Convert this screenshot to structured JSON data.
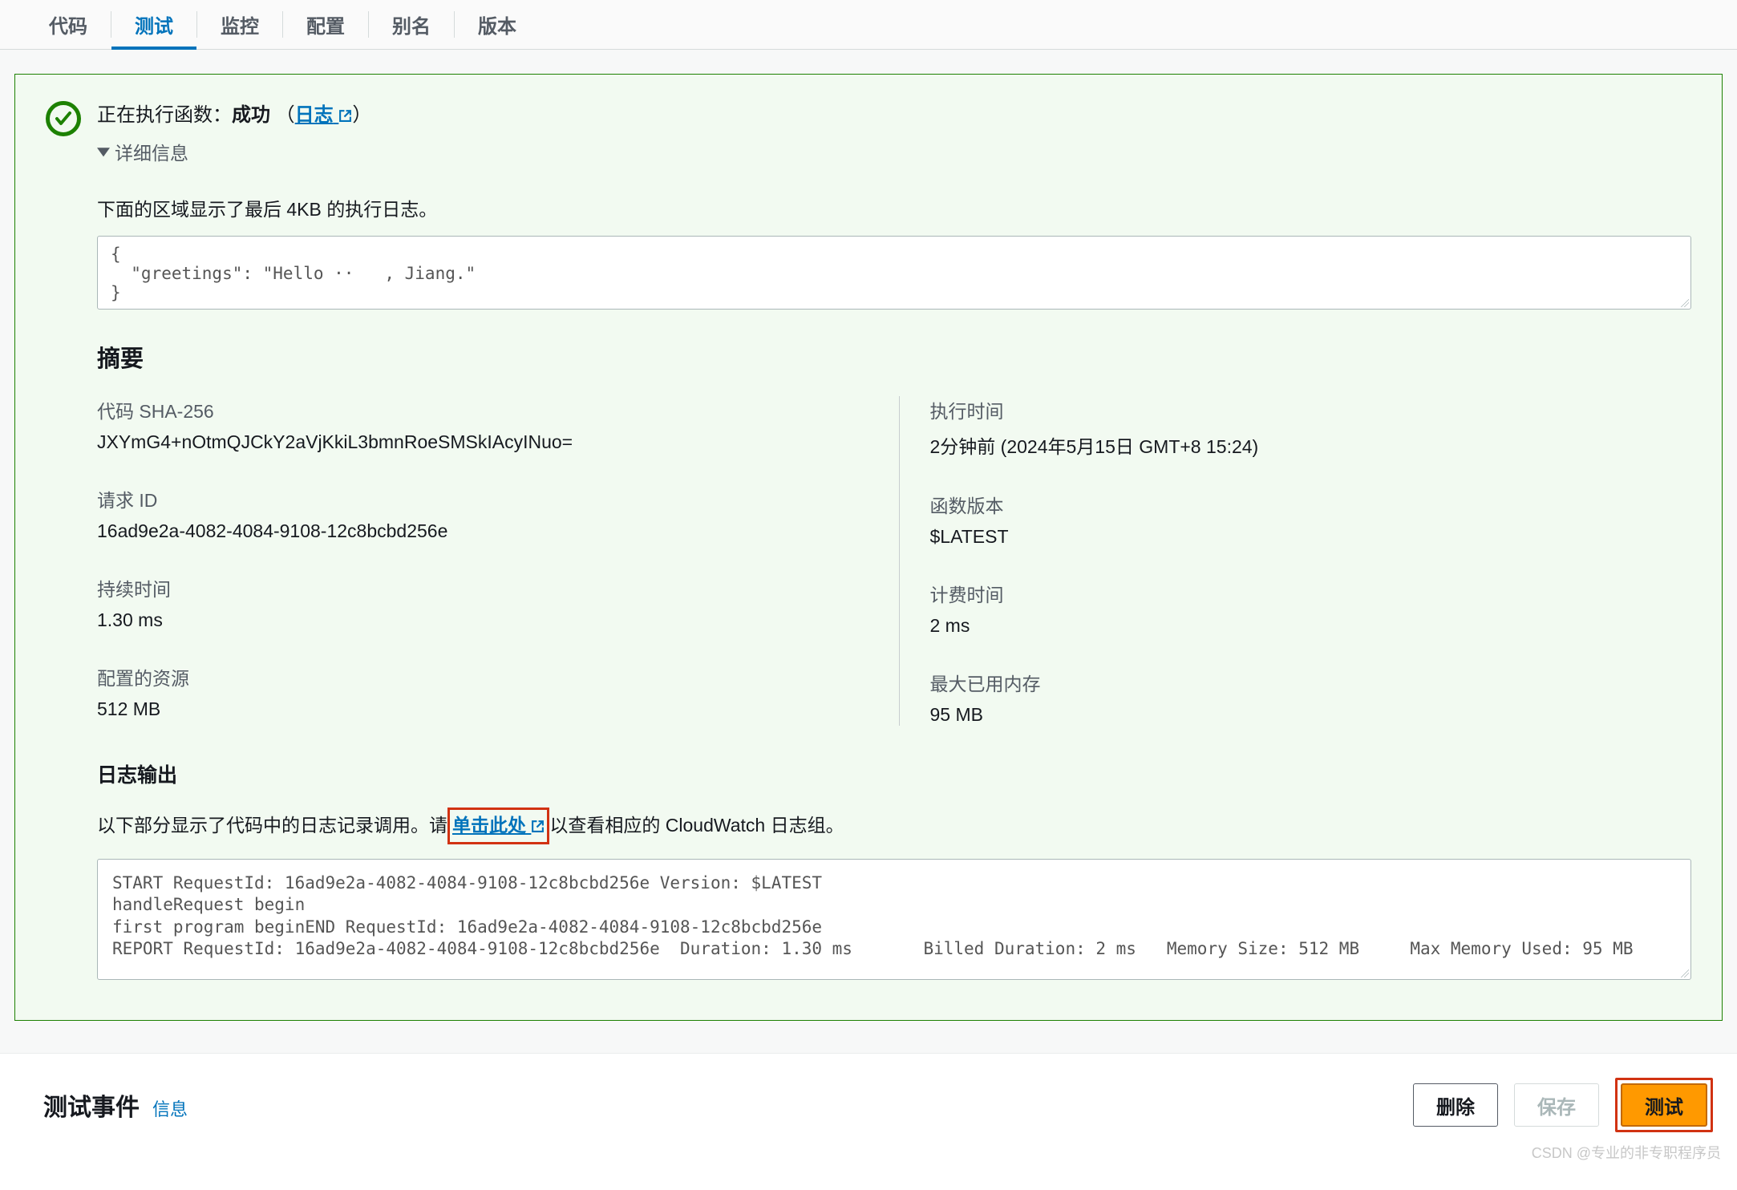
{
  "tabs": [
    "代码",
    "测试",
    "监控",
    "配置",
    "别名",
    "版本"
  ],
  "activeTabIndex": 1,
  "banner": {
    "prefix": "正在执行函数：",
    "status": "成功",
    "logsLinkLabel": "日志",
    "detailsLabel": "详细信息"
  },
  "introText": "下面的区域显示了最后 4KB 的执行日志。",
  "response": "{\n  \"greetings\": \"Hello ··   , Jiang.\"\n}",
  "summaryHeading": "摘要",
  "kv": {
    "sha": {
      "k": "代码 SHA-256",
      "v": "JXYmG4+nOtmQJCkY2aVjKkiL3bmnRoeSMSkIAcyINuo="
    },
    "time": {
      "k": "执行时间",
      "v": "2分钟前 (2024年5月15日 GMT+8 15:24)"
    },
    "reqid": {
      "k": "请求 ID",
      "v": "16ad9e2a-4082-4084-9108-12c8bcbd256e"
    },
    "ver": {
      "k": "函数版本",
      "v": "$LATEST"
    },
    "dur": {
      "k": "持续时间",
      "v": "1.30 ms"
    },
    "bill": {
      "k": "计费时间",
      "v": "2 ms"
    },
    "res": {
      "k": "配置的资源",
      "v": "512 MB"
    },
    "mem": {
      "k": "最大已用内存",
      "v": "95 MB"
    }
  },
  "logHeading": "日志输出",
  "logIntro": {
    "pre": "以下部分显示了代码中的日志记录调用。请",
    "link": "单击此处",
    "post": "以查看相应的 CloudWatch 日志组。"
  },
  "logText": "START RequestId: 16ad9e2a-4082-4084-9108-12c8bcbd256e Version: $LATEST\nhandleRequest begin\nfirst program beginEND RequestId: 16ad9e2a-4082-4084-9108-12c8bcbd256e\nREPORT RequestId: 16ad9e2a-4082-4084-9108-12c8bcbd256e  Duration: 1.30 ms       Billed Duration: 2 ms   Memory Size: 512 MB     Max Memory Used: 95 MB",
  "footer": {
    "title": "测试事件",
    "info": "信息",
    "delete": "删除",
    "save": "保存",
    "test": "测试"
  },
  "watermark": "CSDN @专业的非专职程序员"
}
